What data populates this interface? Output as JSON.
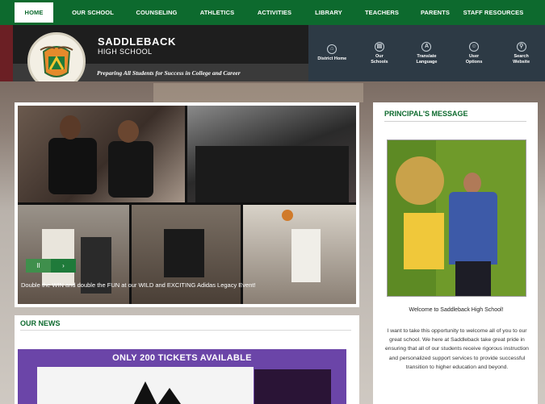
{
  "nav": {
    "items": [
      {
        "label": "HOME",
        "active": true
      },
      {
        "label": "OUR SCHOOL"
      },
      {
        "label": "COUNSELING"
      },
      {
        "label": "ATHLETICS"
      },
      {
        "label": "ACTIVITIES"
      },
      {
        "label": "LIBRARY"
      },
      {
        "label": "TEACHERS"
      },
      {
        "label": "PARENTS"
      },
      {
        "label": "STAFF RESOURCES"
      }
    ]
  },
  "header": {
    "school_name": "SADDLEBACK",
    "school_sub": "HIGH SCHOOL",
    "tagline": "Preparing All Students for Success in College and Career",
    "links": [
      {
        "label": "District Home",
        "icon": "house-icon"
      },
      {
        "label": "Our Schools",
        "icon": "schools-icon"
      },
      {
        "label": "Translate Language",
        "icon": "translate-icon"
      },
      {
        "label": "User Options",
        "icon": "user-icon"
      },
      {
        "label": "Search Website",
        "icon": "search-icon"
      }
    ]
  },
  "slideshow": {
    "caption": "Double the WIN and double the FUN at our WILD and EXCITING Adidas Legacy Event!",
    "prev": "‹‹",
    "pause": "II",
    "next": "›"
  },
  "news": {
    "title": "OUR NEWS",
    "promo": "ONLY 200 TICKETS AVAILABLE"
  },
  "principal": {
    "title": "PRINCIPAL'S MESSAGE",
    "welcome": "Welcome to Saddleback High School!",
    "body": "I want to take this opportunity to welcome all of you to our great school. We here at Saddleback take great pride in ensuring that all of our students receive rigorous instruction and personalized support services to provide successful transition to higher education and beyond."
  },
  "colors": {
    "nav_green": "#0d6a2e",
    "header_dark": "#1e1e1e",
    "header_blue": "#2d3a45",
    "promo_purple": "#6b45a8"
  }
}
